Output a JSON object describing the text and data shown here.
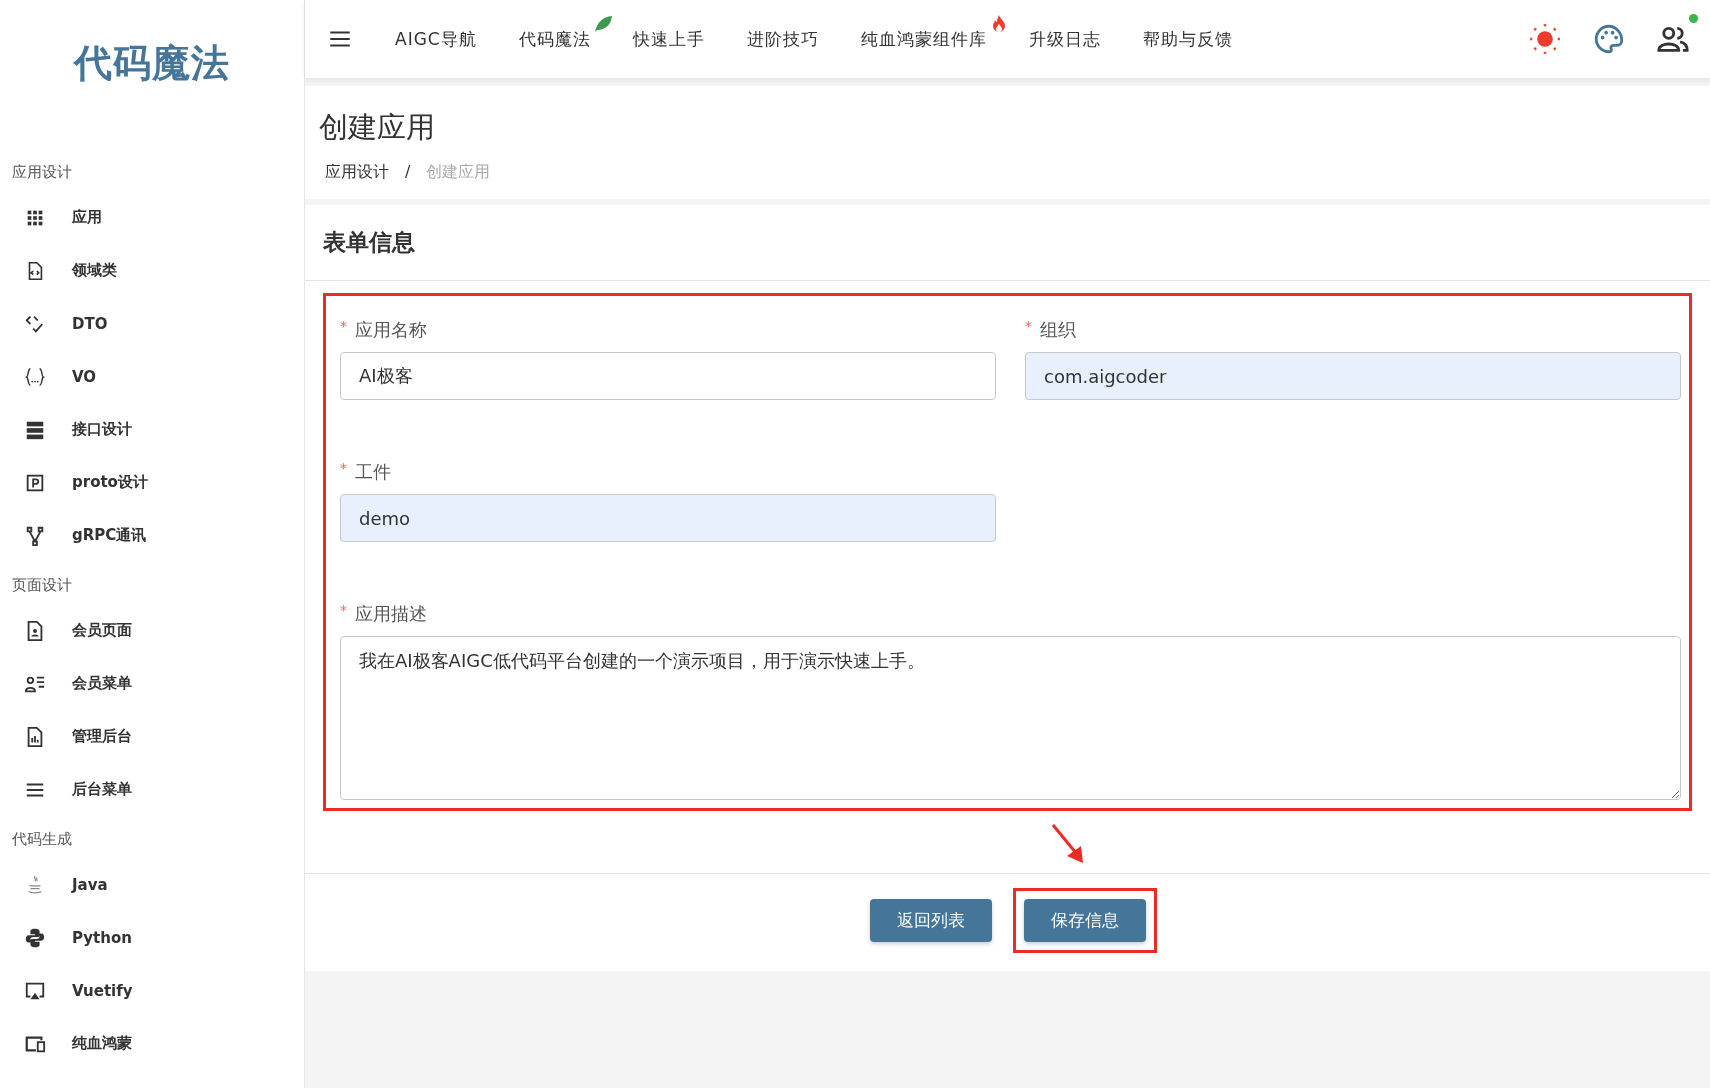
{
  "sidebar": {
    "logo": "代码魔法",
    "sections": [
      {
        "title": "应用设计",
        "items": [
          {
            "label": "应用"
          },
          {
            "label": "领域类"
          },
          {
            "label": "DTO"
          },
          {
            "label": "VO"
          },
          {
            "label": "接口设计"
          },
          {
            "label": "proto设计"
          },
          {
            "label": "gRPC通讯"
          }
        ]
      },
      {
        "title": "页面设计",
        "items": [
          {
            "label": "会员页面"
          },
          {
            "label": "会员菜单"
          },
          {
            "label": "管理后台"
          },
          {
            "label": "后台菜单"
          }
        ]
      },
      {
        "title": "代码生成",
        "items": [
          {
            "label": "Java"
          },
          {
            "label": "Python"
          },
          {
            "label": "Vuetify"
          },
          {
            "label": "纯血鸿蒙"
          }
        ]
      }
    ]
  },
  "topbar": {
    "nav": [
      {
        "label": "AIGC导航",
        "kind": "plain"
      },
      {
        "label": "代码魔法",
        "kind": "leaf"
      },
      {
        "label": "快速上手",
        "kind": "plain"
      },
      {
        "label": "进阶技巧",
        "kind": "plain"
      },
      {
        "label": "纯血鸿蒙组件库",
        "kind": "hot"
      },
      {
        "label": "升级日志",
        "kind": "plain"
      },
      {
        "label": "帮助与反馈",
        "kind": "plain"
      }
    ],
    "user_online": true
  },
  "page": {
    "title": "创建应用",
    "breadcrumb": [
      {
        "label": "应用设计",
        "current": false
      },
      {
        "label": "创建应用",
        "current": true
      }
    ],
    "separator": "/"
  },
  "form": {
    "title": "表单信息",
    "fields": [
      {
        "kind": "input",
        "marker": "*",
        "label": "应用名称",
        "value": "AI极客",
        "autofilled": false
      },
      {
        "kind": "input",
        "marker": "*",
        "label": "组织",
        "value": "com.aigcoder",
        "autofilled": true
      },
      {
        "kind": "input",
        "marker": "*",
        "label": "工件",
        "value": "demo",
        "autofilled": true
      },
      {
        "kind": "textarea",
        "marker": "*",
        "label": "应用描述",
        "value": "我在AI极客AIGC低代码平台创建的一个演示项目，用于演示快速上手。",
        "autofilled": false
      }
    ],
    "buttons": [
      {
        "label": "返回列表",
        "highlighted": false
      },
      {
        "label": "保存信息",
        "highlighted": true
      }
    ]
  }
}
